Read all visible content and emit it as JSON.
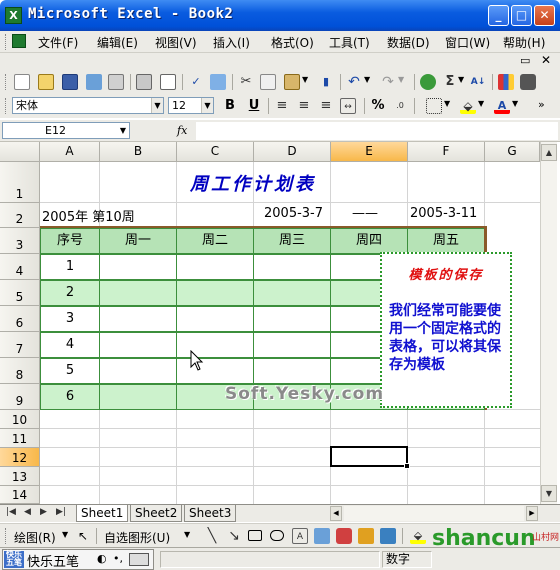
{
  "window": {
    "title": "Microsoft Excel - Book2",
    "app_icon": "excel-icon",
    "buttons": [
      "minimize-icon",
      "maximize-icon",
      "close-icon"
    ]
  },
  "menu": {
    "items": [
      "文件(F)",
      "编辑(E)",
      "视图(V)",
      "插入(I)",
      "格式(O)",
      "工具(T)",
      "数据(D)",
      "窗口(W)",
      "帮助(H)"
    ]
  },
  "toolbar": {
    "font_name": "宋体",
    "font_size": "12",
    "bold": "B",
    "underline": "U",
    "percent": "%"
  },
  "formula_bar": {
    "name_box": "E12",
    "fx": "fx",
    "value": ""
  },
  "grid": {
    "columns": [
      "A",
      "B",
      "C",
      "D",
      "E",
      "F",
      "G"
    ],
    "selected_column": "E",
    "rows": [
      "1",
      "2",
      "3",
      "4",
      "5",
      "6",
      "7",
      "8",
      "9",
      "10",
      "11",
      "12",
      "13",
      "14"
    ],
    "selected_row": "12"
  },
  "sheet": {
    "title": "周工作计划表",
    "year_week": "2005年  第10周",
    "start_date": "2005-3-7",
    "dash": "——",
    "end_date": "2005-3-11",
    "table_headers": [
      "序号",
      "周一",
      "周二",
      "周三",
      "周四",
      "周五"
    ],
    "row_numbers": [
      "1",
      "2",
      "3",
      "4",
      "5",
      "6"
    ]
  },
  "note": {
    "title": "模板的保存",
    "body": "我们经常可能要使用一个固定格式的表格，可以将其保存为模板"
  },
  "watermark": "Soft.Yesky.com",
  "sheet_tabs": [
    "Sheet1",
    "Sheet2",
    "Sheet3"
  ],
  "active_tab": "Sheet1",
  "draw_bar": {
    "draw_label": "绘图(R)",
    "autoshape_label": "自选图形(U)"
  },
  "status": {
    "ime_label": "快乐五笔",
    "ime_logo": "快乐五笔",
    "mode": "数字"
  },
  "site_logo": {
    "text": "shancun",
    "sub": "山村网"
  }
}
